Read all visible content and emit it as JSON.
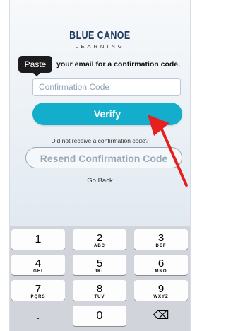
{
  "logo": {
    "title": "BLUE CANOE",
    "subtitle": "LEARNING"
  },
  "paste_tooltip": "Paste",
  "instructions": "your email for a confirmation code.",
  "code_input": {
    "placeholder": "Confirmation Code",
    "value": ""
  },
  "verify_label": "Verify",
  "no_code_text": "Did not receive a confirmation code?",
  "resend_label": "Resend Confirmation Code",
  "go_back_label": "Go Back",
  "keyboard": {
    "keys": [
      {
        "num": "1",
        "letters": ""
      },
      {
        "num": "2",
        "letters": "ABC"
      },
      {
        "num": "3",
        "letters": "DEF"
      },
      {
        "num": "4",
        "letters": "GHI"
      },
      {
        "num": "5",
        "letters": "JKL"
      },
      {
        "num": "6",
        "letters": "MNO"
      },
      {
        "num": "7",
        "letters": "PQRS"
      },
      {
        "num": "8",
        "letters": "TUV"
      },
      {
        "num": "9",
        "letters": "WXYZ"
      },
      {
        "num": ".",
        "letters": ""
      },
      {
        "num": "0",
        "letters": ""
      },
      {
        "num": "⌫",
        "letters": ""
      }
    ]
  },
  "colors": {
    "verify": "#12aecb",
    "arrow": "#e5201f",
    "keyboard_bg": "#d1d5db"
  },
  "icons": {
    "annotation_arrow": "arrow-annotation-icon",
    "delete": "backspace-icon"
  }
}
